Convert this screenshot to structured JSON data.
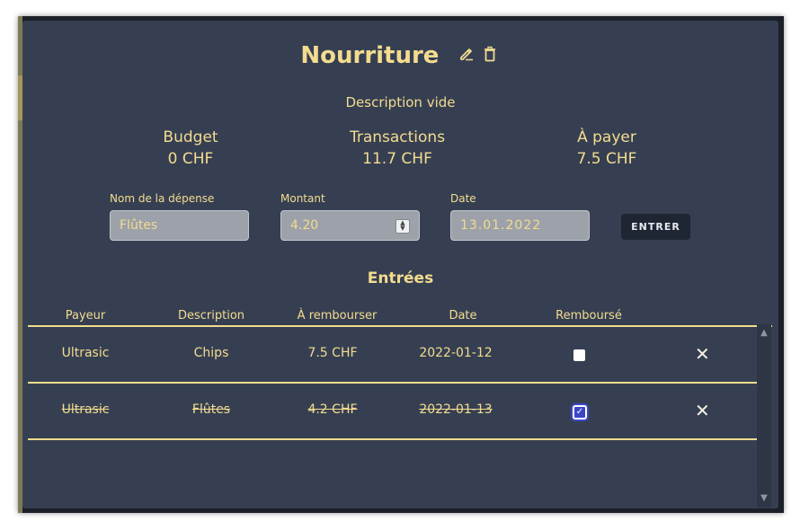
{
  "category": {
    "title": "Nourriture",
    "description": "Description vide"
  },
  "stats": [
    {
      "label": "Budget",
      "value": "0 CHF"
    },
    {
      "label": "Transactions",
      "value": "11.7 CHF"
    },
    {
      "label": "À payer",
      "value": "7.5 CHF"
    }
  ],
  "form": {
    "name_label": "Nom de la dépense",
    "name_value": "Flûtes",
    "amount_label": "Montant",
    "amount_value": "4.20",
    "date_label": "Date",
    "date_value": "13.01.2022",
    "submit_label": "ENTRER"
  },
  "entries": {
    "title": "Entrées",
    "columns": [
      "Payeur",
      "Description",
      "À rembourser",
      "Date",
      "Remboursé"
    ],
    "rows": [
      {
        "payer": "Ultrasic",
        "description": "Chips",
        "amount": "7.5 CHF",
        "date": "2022-01-12",
        "reimbursed": false
      },
      {
        "payer": "Ultrasic",
        "description": "Flûtes",
        "amount": "4.2 CHF",
        "date": "2022-01-13",
        "reimbursed": true
      }
    ]
  },
  "icons": {
    "edit": "pencil-icon",
    "delete_category": "trash-icon",
    "delete_row": "close-icon"
  },
  "colors": {
    "accent": "#f3dc8f",
    "modal_bg": "#363f52",
    "checkbox_checked": "#3b46c6"
  }
}
